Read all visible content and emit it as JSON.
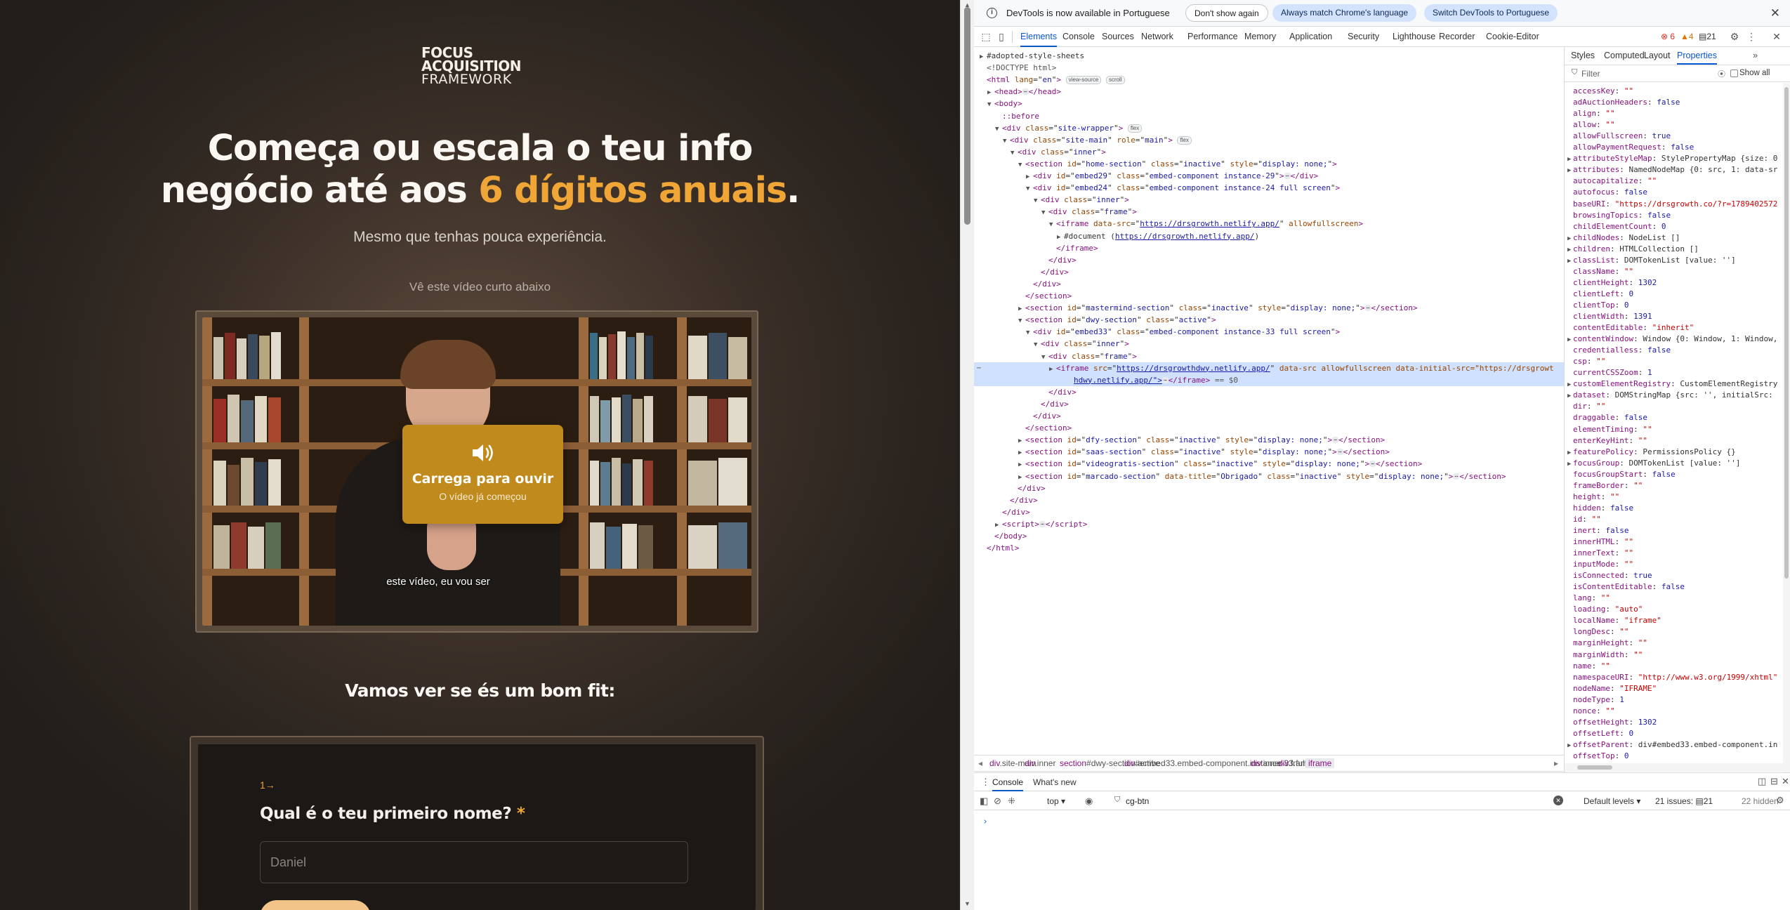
{
  "site": {
    "logo": {
      "line1": "FOCUS",
      "line2": "ACQUISITION",
      "line3": "FRAMEWORK"
    },
    "headline": {
      "part1": "Começa ou escala o teu info",
      "part2": "negócio até aos ",
      "highlight": "6 dígitos anuais",
      "part3": "."
    },
    "subline": "Mesmo que tenhas pouca experiência.",
    "watch_text": "Vê este vídeo curto abaixo",
    "video": {
      "sound_title": "Carrega para ouvir",
      "sound_subtitle": "O vídeo já começou",
      "caption": "este vídeo, eu vou ser",
      "icon": "speaker-icon"
    },
    "fit_title": "Vamos ver se és um bom fit:",
    "form": {
      "question_number": "1→",
      "question": "Qual é o teu primeiro nome?",
      "required_mark": "*",
      "input_placeholder": "Daniel",
      "input_value": ""
    },
    "colors": {
      "accent": "#f0a637",
      "button": "#c08a1c",
      "background": "#2b241f"
    }
  },
  "devtools": {
    "infobar": {
      "message": "DevTools is now available in Portuguese",
      "btn_dont_show": "Don't show again",
      "btn_match": "Always match Chrome's language",
      "btn_switch": "Switch DevTools to Portuguese"
    },
    "tabs": [
      "Elements",
      "Console",
      "Sources",
      "Network",
      "Performance",
      "Memory",
      "Application",
      "Security",
      "Lighthouse",
      "Recorder",
      "Cookie-Editor"
    ],
    "active_tab": "Elements",
    "counts": {
      "errors": "6",
      "warnings": "4",
      "messages": "21"
    },
    "dom": [
      {
        "indent": 0,
        "tri": "▶",
        "html": "#adopted-style-sheets",
        "kind": "plain"
      },
      {
        "indent": 0,
        "tri": "",
        "html": "<!DOCTYPE html>",
        "kind": "comment"
      },
      {
        "indent": 0,
        "tri": "",
        "tag": "html",
        "attrs": [
          [
            "lang",
            "en"
          ]
        ],
        "pills": [
          "view-source",
          "scroll"
        ],
        "open": true
      },
      {
        "indent": 1,
        "tri": "▶",
        "tag": "head",
        "collapsed": true
      },
      {
        "indent": 1,
        "tri": "▼",
        "tag": "body",
        "open": true
      },
      {
        "indent": 2,
        "tri": "",
        "html": "::before",
        "kind": "pseudo"
      },
      {
        "indent": 2,
        "tri": "▼",
        "tag": "div",
        "attrs": [
          [
            "class",
            "site-wrapper"
          ]
        ],
        "pills": [
          "flex"
        ],
        "open": true
      },
      {
        "indent": 3,
        "tri": "▼",
        "tag": "div",
        "attrs": [
          [
            "class",
            "site-main"
          ],
          [
            "role",
            "main"
          ]
        ],
        "pills": [
          "flex"
        ],
        "open": true
      },
      {
        "indent": 4,
        "tri": "▼",
        "tag": "div",
        "attrs": [
          [
            "class",
            "inner"
          ]
        ],
        "open": true
      },
      {
        "indent": 5,
        "tri": "▼",
        "tag": "section",
        "attrs": [
          [
            "id",
            "home-section"
          ],
          [
            "class",
            "inactive"
          ],
          [
            "style",
            "display: none;"
          ]
        ],
        "open": true
      },
      {
        "indent": 6,
        "tri": "▶",
        "tag": "div",
        "attrs": [
          [
            "id",
            "embed29"
          ],
          [
            "class",
            "embed-component instance-29"
          ]
        ],
        "collapsed": true
      },
      {
        "indent": 6,
        "tri": "▼",
        "tag": "div",
        "attrs": [
          [
            "id",
            "embed24"
          ],
          [
            "class",
            "embed-component instance-24 full screen"
          ]
        ],
        "open": true
      },
      {
        "indent": 7,
        "tri": "▼",
        "tag": "div",
        "attrs": [
          [
            "class",
            "inner"
          ]
        ],
        "open": true
      },
      {
        "indent": 8,
        "tri": "▼",
        "tag": "div",
        "attrs": [
          [
            "class",
            "frame"
          ]
        ],
        "open": true
      },
      {
        "indent": 9,
        "tri": "▼",
        "tag": "iframe",
        "attrs": [
          [
            "data-src",
            "https://drsgrowth.netlify.app/",
            "link"
          ]
        ],
        "bool": "allowfullscreen",
        "open": true
      },
      {
        "indent": 10,
        "tri": "▶",
        "html": "#document (",
        "link": "https://drsgrowth.netlify.app/",
        "after": ")",
        "kind": "doc"
      },
      {
        "indent": 9,
        "tri": "",
        "close": "iframe"
      },
      {
        "indent": 8,
        "tri": "",
        "close": "div"
      },
      {
        "indent": 7,
        "tri": "",
        "close": "div"
      },
      {
        "indent": 6,
        "tri": "",
        "close": "div"
      },
      {
        "indent": 5,
        "tri": "",
        "close": "section"
      },
      {
        "indent": 5,
        "tri": "▶",
        "tag": "section",
        "attrs": [
          [
            "id",
            "mastermind-section"
          ],
          [
            "class",
            "inactive"
          ],
          [
            "style",
            "display: none;"
          ]
        ],
        "collapsed": true
      },
      {
        "indent": 5,
        "tri": "▼",
        "tag": "section",
        "attrs": [
          [
            "id",
            "dwy-section"
          ],
          [
            "class",
            "active"
          ]
        ],
        "open": true
      },
      {
        "indent": 6,
        "tri": "▼",
        "tag": "div",
        "attrs": [
          [
            "id",
            "embed33"
          ],
          [
            "class",
            "embed-component instance-33 full screen"
          ]
        ],
        "open": true
      },
      {
        "indent": 7,
        "tri": "▼",
        "tag": "div",
        "attrs": [
          [
            "class",
            "inner"
          ]
        ],
        "open": true
      },
      {
        "indent": 8,
        "tri": "▼",
        "tag": "div",
        "attrs": [
          [
            "class",
            "frame"
          ]
        ],
        "open": true
      },
      {
        "indent": 9,
        "tri": "▶",
        "tag": "iframe",
        "attrs": [
          [
            "src",
            "https://drsgrowthdwy.netlify.app/",
            "link"
          ]
        ],
        "bool": "data-src allowfullscreen",
        "tail": "data-initial-src=\"https://drsgrowt",
        "selected": true
      },
      {
        "indent": 9,
        "tri": "",
        "html": "hdwy.netlify.app/\">",
        "tail_collapsed": true,
        "dollar": " == $0",
        "kind": "cont",
        "selected": true
      },
      {
        "indent": 8,
        "tri": "",
        "close": "div"
      },
      {
        "indent": 7,
        "tri": "",
        "close": "div"
      },
      {
        "indent": 6,
        "tri": "",
        "close": "div"
      },
      {
        "indent": 5,
        "tri": "",
        "close": "section"
      },
      {
        "indent": 5,
        "tri": "▶",
        "tag": "section",
        "attrs": [
          [
            "id",
            "dfy-section"
          ],
          [
            "class",
            "inactive"
          ],
          [
            "style",
            "display: none;"
          ]
        ],
        "collapsed": true
      },
      {
        "indent": 5,
        "tri": "▶",
        "tag": "section",
        "attrs": [
          [
            "id",
            "saas-section"
          ],
          [
            "class",
            "inactive"
          ],
          [
            "style",
            "display: none;"
          ]
        ],
        "collapsed": true
      },
      {
        "indent": 5,
        "tri": "▶",
        "tag": "section",
        "attrs": [
          [
            "id",
            "videogratis-section"
          ],
          [
            "class",
            "inactive"
          ],
          [
            "style",
            "display: none;"
          ]
        ],
        "collapsed": true
      },
      {
        "indent": 5,
        "tri": "▶",
        "tag": "section",
        "attrs": [
          [
            "id",
            "marcado-section"
          ],
          [
            "data-title",
            "Obrigado"
          ],
          [
            "class",
            "inactive"
          ],
          [
            "style",
            "display: none;"
          ]
        ],
        "collapsed": true
      },
      {
        "indent": 4,
        "tri": "",
        "close": "div"
      },
      {
        "indent": 3,
        "tri": "",
        "close": "div"
      },
      {
        "indent": 2,
        "tri": "",
        "close": "div"
      },
      {
        "indent": 2,
        "tri": "▶",
        "tag": "script",
        "collapsed": true
      },
      {
        "indent": 1,
        "tri": "",
        "close": "body"
      },
      {
        "indent": 0,
        "tri": "",
        "close": "html"
      }
    ],
    "breadcrumbs": [
      {
        "tag": "div",
        "cls": ".site-main"
      },
      {
        "tag": "div",
        "cls": ".inner"
      },
      {
        "tag": "section",
        "cls": "#dwy-section.active"
      },
      {
        "tag": "div",
        "cls": "#embed33.embed-component.instance-33.full.screen"
      },
      {
        "tag": "div",
        "cls": ".inner"
      },
      {
        "tag": "div",
        "cls": ".frame"
      },
      {
        "tag": "iframe",
        "cls": ""
      }
    ],
    "side_tabs": [
      "Styles",
      "Computed",
      "Layout",
      "Properties"
    ],
    "side_active": "Properties",
    "filter_placeholder": "Filter",
    "show_all": "Show all",
    "properties": [
      [
        "",
        "accessKey",
        "\"\"",
        "s"
      ],
      [
        "",
        "adAuctionHeaders",
        "false",
        "b"
      ],
      [
        "",
        "align",
        "\"\"",
        "s"
      ],
      [
        "",
        "allow",
        "\"\"",
        "s"
      ],
      [
        "",
        "allowFullscreen",
        "true",
        "b"
      ],
      [
        "",
        "allowPaymentRequest",
        "false",
        "b"
      ],
      [
        "▶",
        "attributeStyleMap",
        "StylePropertyMap {size: 0",
        "o"
      ],
      [
        "▶",
        "attributes",
        "NamedNodeMap {0: src, 1: data-sr",
        "o"
      ],
      [
        "",
        "autocapitalize",
        "\"\"",
        "s"
      ],
      [
        "",
        "autofocus",
        "false",
        "b"
      ],
      [
        "",
        "baseURI",
        "\"https://drsgrowth.co/?r=1789402572",
        "s"
      ],
      [
        "",
        "browsingTopics",
        "false",
        "b"
      ],
      [
        "",
        "childElementCount",
        "0",
        "n"
      ],
      [
        "▶",
        "childNodes",
        "NodeList []",
        "o"
      ],
      [
        "▶",
        "children",
        "HTMLCollection []",
        "o"
      ],
      [
        "▶",
        "classList",
        "DOMTokenList [value: '']",
        "o"
      ],
      [
        "",
        "className",
        "\"\"",
        "s"
      ],
      [
        "",
        "clientHeight",
        "1302",
        "n"
      ],
      [
        "",
        "clientLeft",
        "0",
        "n"
      ],
      [
        "",
        "clientTop",
        "0",
        "n"
      ],
      [
        "",
        "clientWidth",
        "1391",
        "n"
      ],
      [
        "",
        "contentEditable",
        "\"inherit\"",
        "s"
      ],
      [
        "▶",
        "contentWindow",
        "Window {0: Window, 1: Window,",
        "o"
      ],
      [
        "",
        "credentialless",
        "false",
        "b"
      ],
      [
        "",
        "csp",
        "\"\"",
        "s"
      ],
      [
        "",
        "currentCSSZoom",
        "1",
        "n"
      ],
      [
        "▶",
        "customElementRegistry",
        "CustomElementRegistry",
        "o"
      ],
      [
        "▶",
        "dataset",
        "DOMStringMap {src: '', initialSrc:",
        "o"
      ],
      [
        "",
        "dir",
        "\"\"",
        "s"
      ],
      [
        "",
        "draggable",
        "false",
        "b"
      ],
      [
        "",
        "elementTiming",
        "\"\"",
        "s"
      ],
      [
        "",
        "enterKeyHint",
        "\"\"",
        "s"
      ],
      [
        "▶",
        "featurePolicy",
        "PermissionsPolicy {}",
        "o"
      ],
      [
        "▶",
        "focusGroup",
        "DOMTokenList [value: '']",
        "o"
      ],
      [
        "",
        "focusGroupStart",
        "false",
        "b"
      ],
      [
        "",
        "frameBorder",
        "\"\"",
        "s"
      ],
      [
        "",
        "height",
        "\"\"",
        "s"
      ],
      [
        "",
        "hidden",
        "false",
        "b"
      ],
      [
        "",
        "id",
        "\"\"",
        "s"
      ],
      [
        "",
        "inert",
        "false",
        "b"
      ],
      [
        "",
        "innerHTML",
        "\"\"",
        "s"
      ],
      [
        "",
        "innerText",
        "\"\"",
        "s"
      ],
      [
        "",
        "inputMode",
        "\"\"",
        "s"
      ],
      [
        "",
        "isConnected",
        "true",
        "b"
      ],
      [
        "",
        "isContentEditable",
        "false",
        "b"
      ],
      [
        "",
        "lang",
        "\"\"",
        "s"
      ],
      [
        "",
        "loading",
        "\"auto\"",
        "s"
      ],
      [
        "",
        "localName",
        "\"iframe\"",
        "s"
      ],
      [
        "",
        "longDesc",
        "\"\"",
        "s"
      ],
      [
        "",
        "marginHeight",
        "\"\"",
        "s"
      ],
      [
        "",
        "marginWidth",
        "\"\"",
        "s"
      ],
      [
        "",
        "name",
        "\"\"",
        "s"
      ],
      [
        "",
        "namespaceURI",
        "\"http://www.w3.org/1999/xhtml\"",
        "s"
      ],
      [
        "",
        "nodeName",
        "\"IFRAME\"",
        "s"
      ],
      [
        "",
        "nodeType",
        "1",
        "n"
      ],
      [
        "",
        "nonce",
        "\"\"",
        "s"
      ],
      [
        "",
        "offsetHeight",
        "1302",
        "n"
      ],
      [
        "",
        "offsetLeft",
        "0",
        "n"
      ],
      [
        "▶",
        "offsetParent",
        "div#embed33.embed-component.in",
        "o"
      ],
      [
        "",
        "offsetTop",
        "0",
        "n"
      ]
    ],
    "drawer": {
      "tabs": [
        "Console",
        "What's new"
      ],
      "context": "top",
      "filter_value": "cg-btn",
      "levels": "Default levels",
      "issues": "21 issues:",
      "issues_count": "21",
      "hidden": "22 hidden",
      "prompt": "›"
    }
  }
}
